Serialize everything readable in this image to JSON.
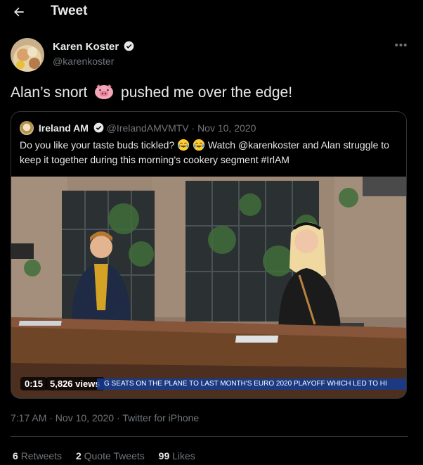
{
  "header": {
    "title": "Tweet"
  },
  "author": {
    "name": "Karen Koster",
    "handle": "@karenkoster"
  },
  "tweet": {
    "text_before": "Alan’s snort",
    "text_after": "pushed me over the edge!"
  },
  "quote": {
    "name": "Ireland AM",
    "meta": "@IrelandAMVMTV · Nov 10, 2020",
    "text_part1": "Do you like your taste buds tickled?",
    "text_part2": "Watch @karenkoster and Alan struggle to keep it together during this morning's cookery segment #IrlAM",
    "video": {
      "time": "0:15",
      "views": "5,826 views",
      "ticker": "G SEATS ON THE PLANE TO LAST MONTH'S EURO 2020 PLAYOFF WHICH LED TO HI"
    }
  },
  "timestamp": "7:17 AM · Nov 10, 2020 · Twitter for iPhone",
  "stats": {
    "retweets_count": "6",
    "retweets_label": "Retweets",
    "quotes_count": "2",
    "quotes_label": "Quote Tweets",
    "likes_count": "99",
    "likes_label": "Likes"
  },
  "colors": {
    "background": "#000000",
    "text": "#e7e9ea",
    "muted": "#71767b",
    "verified": "#1d9bf0",
    "border": "#2f3336"
  }
}
